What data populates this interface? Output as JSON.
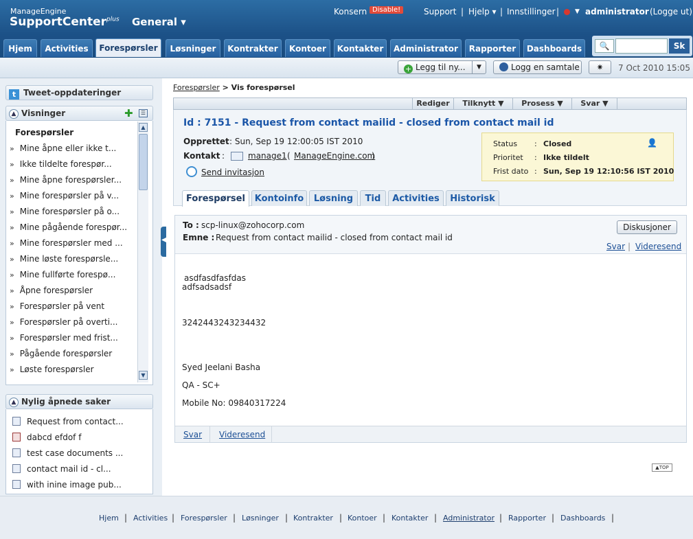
{
  "header": {
    "brand_small": "ManageEngine",
    "brand_big": "SupportCenter",
    "brand_sup": "plus",
    "module": "General ▾",
    "konsern": "Konsern",
    "disable": "Disable!",
    "support": "Support",
    "sep1": "|",
    "help": "Hjelp ▾",
    "sep2": "|",
    "settings": "Innstillinger",
    "sep3": "|",
    "user": "administrator",
    "logout": "(Logge ut)"
  },
  "tabs": [
    "Hjem",
    "Activities",
    "Forespørsler",
    "Løsninger",
    "Kontrakter",
    "Kontoer",
    "Kontakter",
    "Administrator",
    "Rapporter",
    "Dashboards"
  ],
  "search": {
    "go": "Sk"
  },
  "toolbar": {
    "new": "Legg til ny...",
    "log": "Logg en samtale",
    "datetime": "7 Oct 2010 15:05"
  },
  "sidebar": {
    "tweet": "Tweet-oppdateringer",
    "views_title": "Visninger",
    "views_header": "Forespørsler",
    "views": [
      "Mine åpne eller ikke t...",
      "Ikke tildelte forespør...",
      "Mine åpne forespørsler...",
      "Mine forespørsler på v...",
      "Mine forespørsler på o...",
      "Mine pågående forespør...",
      "Mine forespørsler med ...",
      "Mine løste forespørsle...",
      "Mine fullførte forespø...",
      "Åpne forespørsler",
      "Forespørsler på vent",
      "Forespørsler på overti...",
      "Forespørsler med frist...",
      "Pågående forespørsler",
      "Løste forespørsler"
    ],
    "recent_title": "Nylig åpnede saker",
    "recent": [
      "Request from contact...",
      "dabcd efdof f",
      "test case documents ...",
      "contact mail id - cl...",
      "with inine image pub..."
    ]
  },
  "breadcrumb": {
    "link": "Forespørsler",
    "current": " > Vis forespørsel"
  },
  "actions": [
    "Rediger",
    "Tilknytt ▼",
    "Prosess ▼",
    "Svar ▼"
  ],
  "request": {
    "title": "Id : 7151 - Request from contact mailid - closed from contact mail id",
    "created_label": "Opprettet",
    "created": " : Sun, Sep 19 12:00:05 IST 2010",
    "contact_label": "Kontakt",
    "contact_colon": ":",
    "contact_name": "manage1",
    "contact_paren_open": "(",
    "contact_org": "ManageEngine.com",
    "contact_paren_close": ")",
    "invite": "Send invitasjon",
    "status_label": "Status",
    "status": "Closed",
    "priority_label": "Prioritet",
    "priority": "Ikke tildelt",
    "due_label": "Frist dato",
    "due": "Sun, Sep 19 12:10:56 IST 2010",
    "colon": ":"
  },
  "detail_tabs": [
    "Forespørsel",
    "Kontoinfo",
    "Løsning",
    "Tid",
    "Activities",
    "Historisk"
  ],
  "mail": {
    "to_label": "To :",
    "to": "scp-linux@zohocorp.com",
    "subject_label": "Emne :",
    "subject": "Request from contact mailid - closed from contact mail id",
    "discussions": "Diskusjoner",
    "reply": "Svar",
    "forward": "Videresend",
    "sep": "|",
    "body": [
      "asdfasdfasfdas",
      "adfsadsadsf",
      "3242443243234432",
      "Syed Jeelani Basha",
      "QA - SC+",
      "Mobile No: 09840317224"
    ]
  },
  "top_label": "TOP",
  "footer": [
    "Hjem",
    "Activities",
    "Forespørsler",
    "Løsninger",
    "Kontrakter",
    "Kontoer",
    "Kontakter",
    "Administrator",
    "Rapporter",
    "Dashboards"
  ],
  "colors": {
    "header": "#1c5187",
    "link": "#1b56a8",
    "status_bg": "#fbf7d6"
  }
}
